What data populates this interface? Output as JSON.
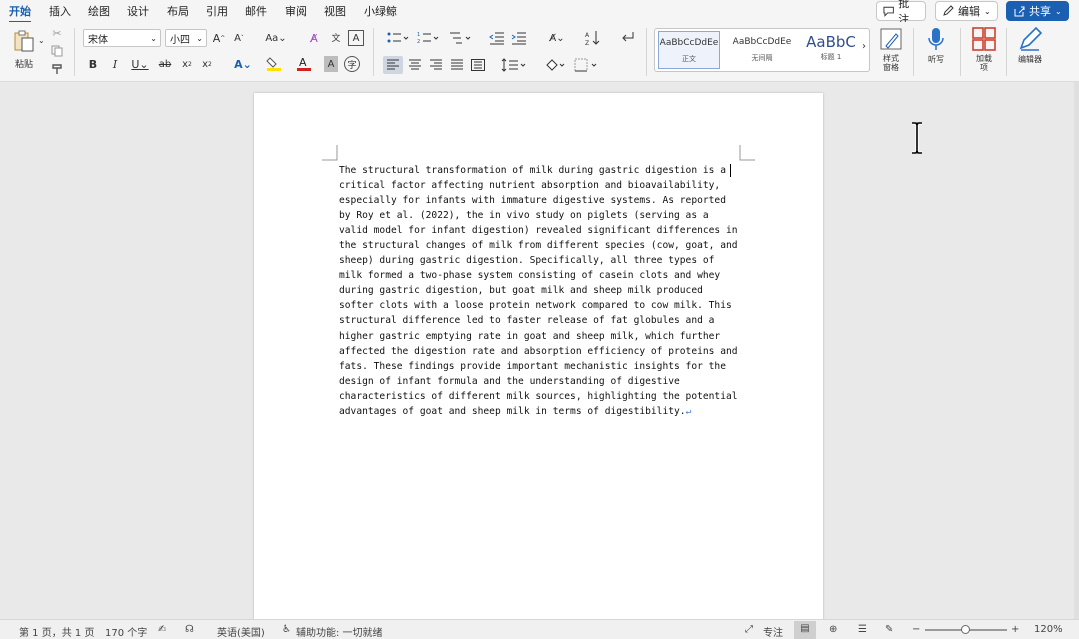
{
  "tabs": [
    "开始",
    "插入",
    "绘图",
    "设计",
    "布局",
    "引用",
    "邮件",
    "审阅",
    "视图",
    "小绿鲸"
  ],
  "topright": {
    "comment": "批注",
    "edit": "编辑",
    "share": "共享"
  },
  "ribbon": {
    "paste": "粘贴",
    "font_name": "宋体",
    "font_size": "小四",
    "styles": [
      {
        "sample": "AaBbCcDdEe",
        "name": "正文"
      },
      {
        "sample": "AaBbCcDdEe",
        "name": "无间隔"
      },
      {
        "sample": "AaBbC",
        "name": "标题 1"
      }
    ],
    "style_pane": "样式\n窗格",
    "dictate": "听写",
    "addins": "加载\n项",
    "editor": "编辑器"
  },
  "document": {
    "lines": [
      "The structural transformation of milk during gastric digestion is a",
      "critical factor affecting nutrient absorption and bioavailability,",
      "especially for infants with immature digestive systems. As reported",
      "by Roy et al. (2022), the in vivo study on piglets (serving as a",
      "valid model for infant digestion) revealed significant differences in",
      "the structural changes of milk from different species (cow, goat, and",
      "sheep) during gastric digestion. Specifically, all three types of",
      "milk formed a two-phase system consisting of casein clots and whey",
      "during gastric digestion, but goat milk and sheep milk produced",
      "softer clots with a loose protein network compared to cow milk. This",
      "structural difference led to faster release of fat globules and a",
      "higher gastric emptying rate in goat and sheep milk, which further",
      "affected the digestion rate and absorption efficiency of proteins and",
      "fats. These findings provide important mechanistic insights for the",
      "design of infant formula and the understanding of digestive",
      "characteristics of different milk sources, highlighting the potential",
      "advantages of goat and sheep milk in terms of digestibility."
    ],
    "para_mark": "↵"
  },
  "status": {
    "page": "第 1 页，共 1 页",
    "words": "170 个字",
    "language": "英语(美国)",
    "accessibility": "辅助功能: 一切就绪",
    "focus": "专注",
    "zoom": "120%",
    "zoom_minus": "−",
    "zoom_plus": "+"
  },
  "colors": {
    "accent": "#1b5fb3",
    "highlight": "#ffe100",
    "font_color": "#d32020"
  },
  "icons": [
    "paste-icon",
    "cut-icon",
    "copy-icon",
    "format-painter-icon",
    "font-grow-icon",
    "font-shrink-icon",
    "change-case-icon",
    "clear-format-icon",
    "phonetic-icon",
    "char-border-icon",
    "bullets-icon",
    "numbering-icon",
    "multilevel-icon",
    "decrease-indent-icon",
    "increase-indent-icon",
    "asian-layout-icon",
    "sort-icon",
    "show-marks-icon",
    "bold-icon",
    "italic-icon",
    "underline-icon",
    "strikethrough-icon",
    "subscript-icon",
    "superscript-icon",
    "text-effects-icon",
    "highlight-icon",
    "font-color-icon",
    "char-shading-icon",
    "enclose-char-icon",
    "align-left-icon",
    "center-icon",
    "align-right-icon",
    "justify-icon",
    "distributed-icon",
    "line-spacing-icon",
    "shading-icon",
    "borders-icon",
    "style-pane-icon",
    "microphone-icon",
    "addins-icon",
    "editor-icon",
    "comment-icon",
    "pen-icon",
    "share-icon"
  ]
}
